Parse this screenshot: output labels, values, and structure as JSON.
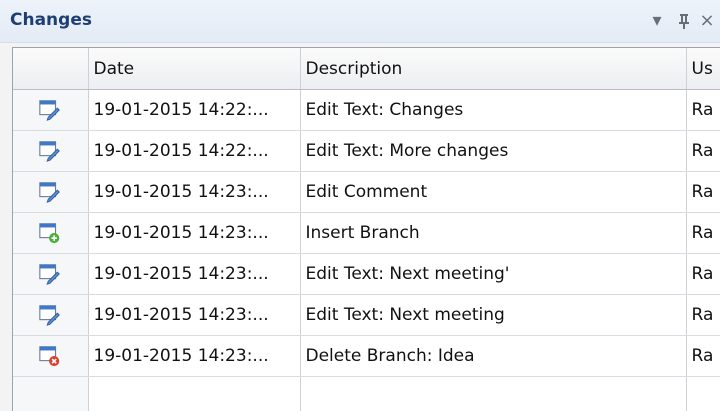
{
  "panel": {
    "title": "Changes",
    "buttons": {
      "dropdown": "▾",
      "pin": "pin-icon",
      "close": "×"
    }
  },
  "table": {
    "columns": [
      "",
      "Date",
      "Description",
      "Us"
    ],
    "rows": [
      {
        "icon": "edit-icon",
        "date": "19-01-2015 14:22:...",
        "description": "Edit Text:  Changes",
        "user": "Ra"
      },
      {
        "icon": "edit-icon",
        "date": "19-01-2015 14:22:...",
        "description": "Edit Text:  More changes",
        "user": "Ra"
      },
      {
        "icon": "edit-icon",
        "date": "19-01-2015 14:23:...",
        "description": "Edit Comment",
        "user": "Ra"
      },
      {
        "icon": "insert-icon",
        "date": "19-01-2015 14:23:...",
        "description": "Insert Branch",
        "user": "Ra"
      },
      {
        "icon": "edit-icon",
        "date": "19-01-2015 14:23:...",
        "description": "Edit Text:  Next meeting'",
        "user": "Ra"
      },
      {
        "icon": "edit-icon",
        "date": "19-01-2015 14:23:...",
        "description": "Edit Text:  Next meeting",
        "user": "Ra"
      },
      {
        "icon": "delete-icon",
        "date": "19-01-2015 14:23:...",
        "description": "Delete Branch: Idea",
        "user": "Ra"
      }
    ]
  },
  "colors": {
    "title": "#1e3f74",
    "icon_blue": "#3f78c8",
    "insert_green": "#4caf37",
    "delete_red": "#d8412f"
  }
}
